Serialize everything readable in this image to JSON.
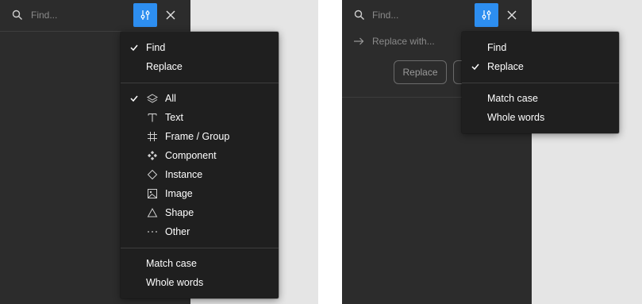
{
  "left": {
    "search": {
      "placeholder": "Find..."
    },
    "menu": {
      "mode_items": [
        {
          "label": "Find",
          "checked": true
        },
        {
          "label": "Replace",
          "checked": false
        }
      ],
      "type_items": [
        {
          "label": "All",
          "icon": "layers-icon",
          "checked": true
        },
        {
          "label": "Text",
          "icon": "text-icon",
          "checked": false
        },
        {
          "label": "Frame / Group",
          "icon": "frame-hash-icon",
          "checked": false
        },
        {
          "label": "Component",
          "icon": "component-icon",
          "checked": false
        },
        {
          "label": "Instance",
          "icon": "instance-diamond-icon",
          "checked": false
        },
        {
          "label": "Image",
          "icon": "image-icon",
          "checked": false
        },
        {
          "label": "Shape",
          "icon": "triangle-icon",
          "checked": false
        },
        {
          "label": "Other",
          "icon": "ellipsis-icon",
          "checked": false
        }
      ],
      "option_items": [
        {
          "label": "Match case",
          "checked": false
        },
        {
          "label": "Whole words",
          "checked": false
        }
      ]
    }
  },
  "right": {
    "search": {
      "placeholder": "Find..."
    },
    "replace": {
      "placeholder": "Replace with..."
    },
    "replace_button": "Replace",
    "menu": {
      "mode_items": [
        {
          "label": "Find",
          "checked": false
        },
        {
          "label": "Replace",
          "checked": true
        }
      ],
      "option_items": [
        {
          "label": "Match case",
          "checked": false
        },
        {
          "label": "Whole words",
          "checked": false
        }
      ]
    }
  },
  "colors": {
    "panel": "#2c2c2c",
    "menu": "#1f1f1f",
    "accent": "#2d8ef0",
    "page_gray": "#e5e5e5"
  }
}
